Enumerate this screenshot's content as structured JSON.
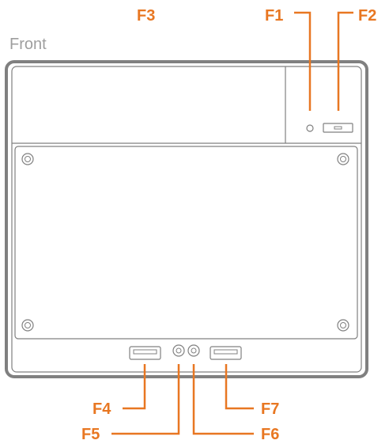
{
  "view_label": "Front",
  "colors": {
    "accent": "#e87722",
    "outline": "#808080",
    "label_gray": "#9e9e9e"
  },
  "callouts": {
    "f1": "F1",
    "f2": "F2",
    "f3": "F3",
    "f4": "F4",
    "f5": "F5",
    "f6": "F6",
    "f7": "F7"
  },
  "components": [
    {
      "id": "f1",
      "icon": "power-led-icon"
    },
    {
      "id": "f2",
      "icon": "power-button-icon"
    },
    {
      "id": "f3",
      "icon": "top-panel-area"
    },
    {
      "id": "f4",
      "icon": "usb-port-icon"
    },
    {
      "id": "f5",
      "icon": "audio-jack-icon"
    },
    {
      "id": "f6",
      "icon": "audio-jack-icon"
    },
    {
      "id": "f7",
      "icon": "usb-port-icon"
    }
  ]
}
